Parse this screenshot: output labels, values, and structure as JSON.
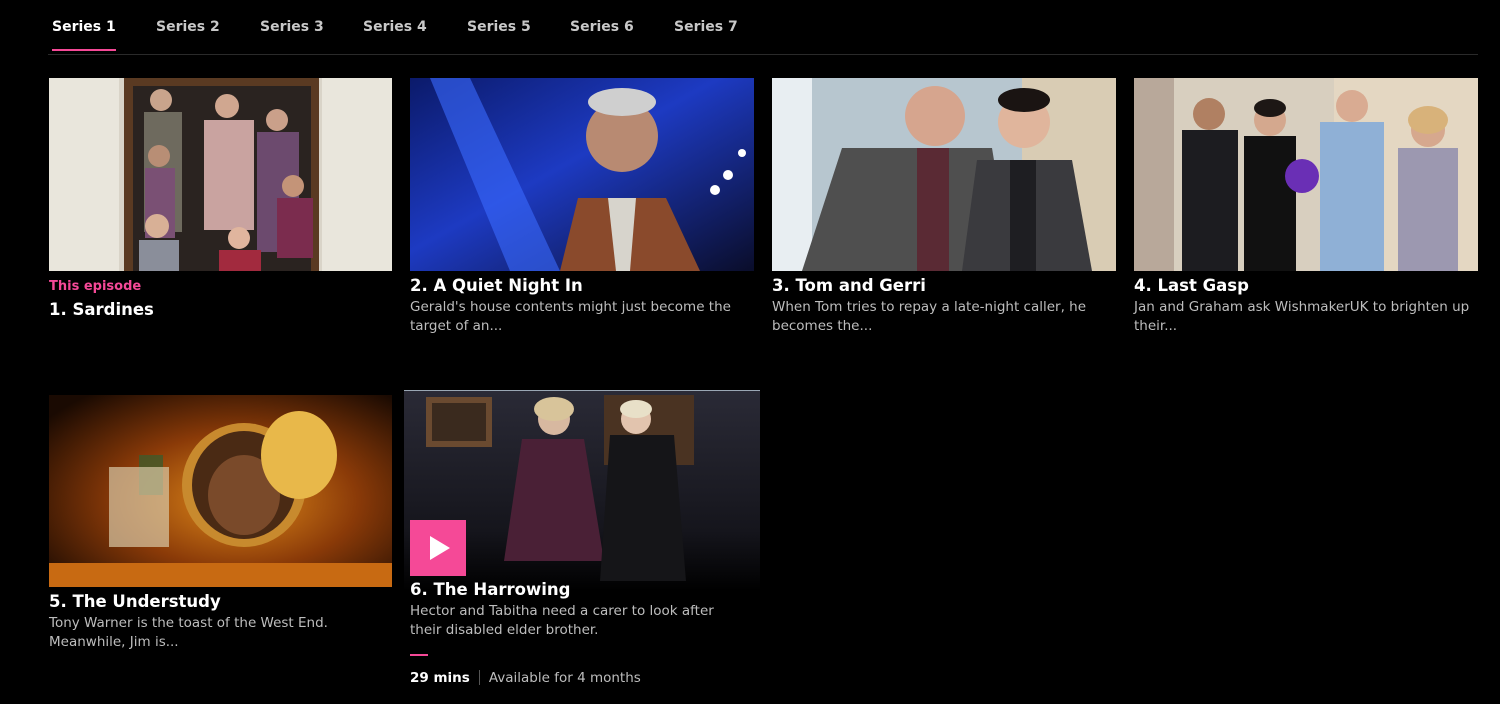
{
  "tabs": [
    {
      "label": "Series 1",
      "active": true
    },
    {
      "label": "Series 2",
      "active": false
    },
    {
      "label": "Series 3",
      "active": false
    },
    {
      "label": "Series 4",
      "active": false
    },
    {
      "label": "Series 5",
      "active": false
    },
    {
      "label": "Series 6",
      "active": false
    },
    {
      "label": "Series 7",
      "active": false
    }
  ],
  "episodes": [
    {
      "label": "This episode",
      "title": "1. Sardines",
      "description": ""
    },
    {
      "title": "2. A Quiet Night In",
      "description": "Gerald's house contents might just become the target of an..."
    },
    {
      "title": "3. Tom and Gerri",
      "description": "When Tom tries to repay a late-night caller, he becomes the..."
    },
    {
      "title": "4. Last Gasp",
      "description": "Jan and Graham ask WishmakerUK to brighten up their..."
    },
    {
      "title": "5. The Understudy",
      "description": "Tony Warner is the toast of the West End. Meanwhile, Jim is..."
    },
    {
      "title": "6. The Harrowing",
      "description": "Hector and Tabitha need a carer to look after their disabled elder brother.",
      "duration": "29 mins",
      "availability": "Available for 4 months"
    }
  ],
  "icons": {
    "play": "play-icon"
  },
  "colors": {
    "accent": "#f54997",
    "background": "#000000"
  }
}
